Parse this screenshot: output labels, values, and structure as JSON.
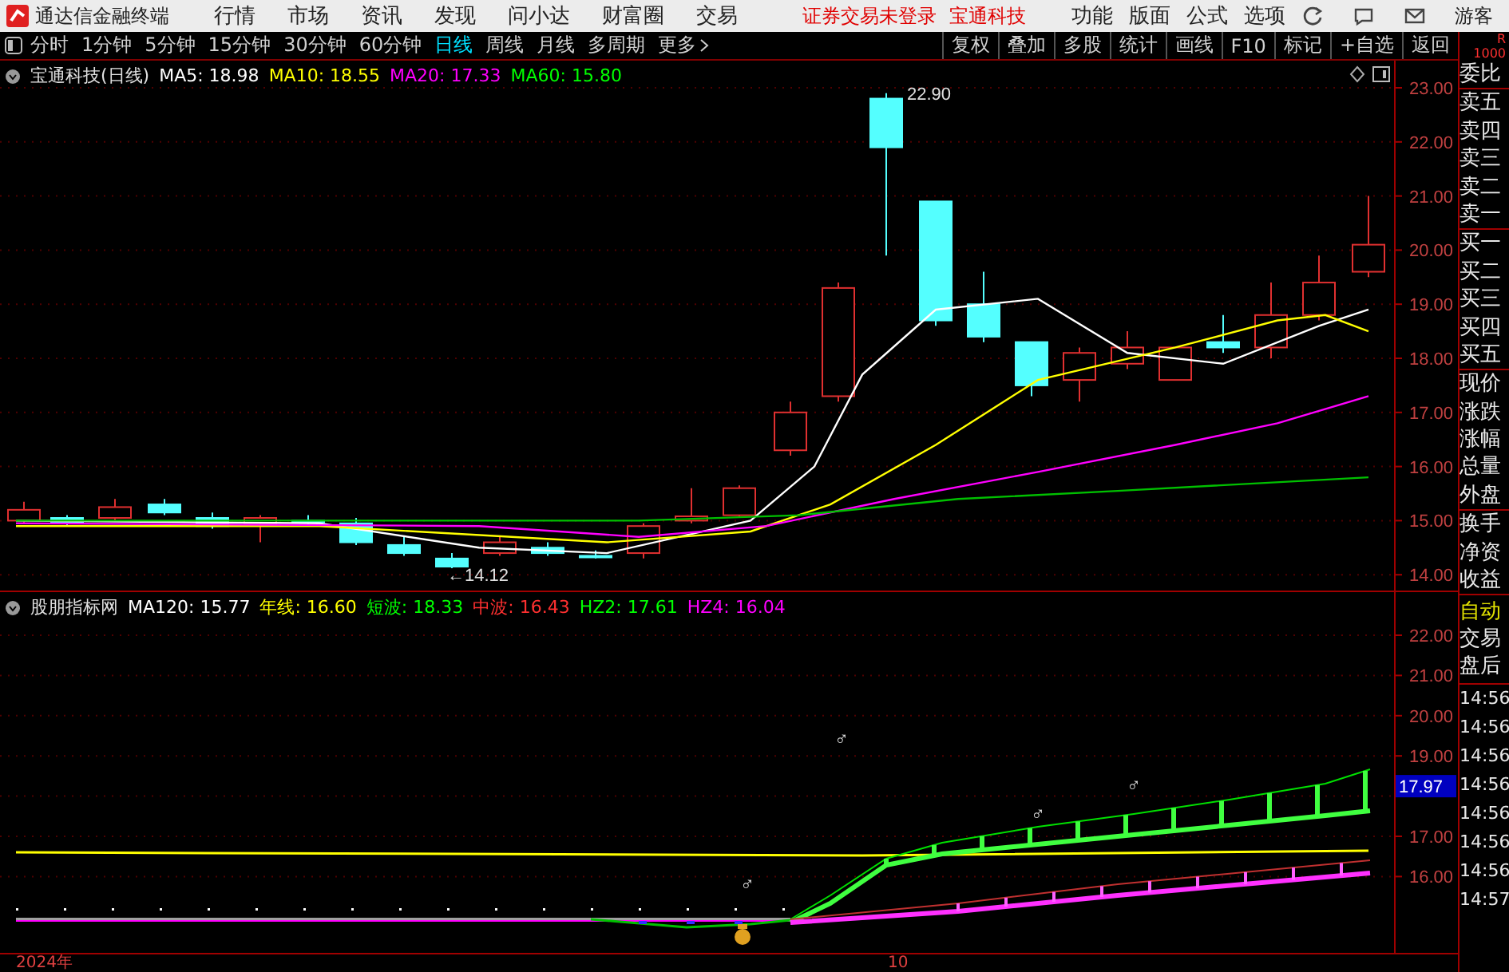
{
  "app": {
    "title": "通达信金融终端"
  },
  "menu": [
    "行情",
    "市场",
    "资讯",
    "发现",
    "问小达",
    "财富圈",
    "交易"
  ],
  "login_status": "证券交易未登录",
  "stock_link": "宝通科技",
  "right_menu": [
    "功能",
    "版面",
    "公式",
    "选项"
  ],
  "user": "游客",
  "toolbar": {
    "periods": [
      {
        "label": "分时",
        "selected": false
      },
      {
        "label": "1分钟",
        "selected": false
      },
      {
        "label": "5分钟",
        "selected": false
      },
      {
        "label": "15分钟",
        "selected": false
      },
      {
        "label": "30分钟",
        "selected": false
      },
      {
        "label": "60分钟",
        "selected": false
      },
      {
        "label": "日线",
        "selected": true
      },
      {
        "label": "周线",
        "selected": false
      },
      {
        "label": "月线",
        "selected": false
      },
      {
        "label": "多周期",
        "selected": false
      }
    ],
    "more": "更多",
    "buttons": [
      "复权",
      "叠加",
      "多股",
      "统计",
      "画线",
      "F10",
      "标记",
      "+自选",
      "返回"
    ]
  },
  "side_header": {
    "label": "R",
    "value": "1000"
  },
  "main_chart": {
    "title": "宝通科技(日线)",
    "legend": [
      {
        "label": "MA5: 18.98",
        "color": "#ffffff"
      },
      {
        "label": "MA10: 18.55",
        "color": "#ffff00"
      },
      {
        "label": "MA20: 17.33",
        "color": "#ff00ff"
      },
      {
        "label": "MA60: 15.80",
        "color": "#00ff00"
      }
    ],
    "price_ticks": [
      "23.00",
      "22.00",
      "21.00",
      "20.00",
      "19.00",
      "18.00",
      "17.00",
      "16.00",
      "15.00",
      "14.00"
    ],
    "high_label": "22.90",
    "low_label": "←14.12"
  },
  "indicator": {
    "title": "股朋指标网",
    "legend": [
      {
        "label": "MA120: 15.77",
        "color": "#ffffff"
      },
      {
        "label": "年线: 16.60",
        "color": "#ffff00"
      },
      {
        "label": "短波: 18.33",
        "color": "#00ff00"
      },
      {
        "label": "中波: 16.43",
        "color": "#ff3030"
      },
      {
        "label": "HZ2: 17.61",
        "color": "#00ff00"
      },
      {
        "label": "HZ4: 16.04",
        "color": "#ff00ff"
      }
    ],
    "ticks": [
      "22.00",
      "21.00",
      "20.00",
      "19.00",
      "17.00",
      "16.00"
    ],
    "price_flag": "17.97",
    "markers": [
      "♂",
      "♂",
      "♂",
      "♂"
    ]
  },
  "x_axis": [
    "2024年",
    "10"
  ],
  "quote_fields": [
    "委比",
    "卖五",
    "卖四",
    "卖三",
    "卖二",
    "卖一",
    "买一",
    "买二",
    "买三",
    "买四",
    "买五",
    "现价",
    "涨跌",
    "涨幅",
    "总量",
    "外盘",
    "换手",
    "净资",
    "收益"
  ],
  "side_modes": [
    {
      "label": "自动",
      "selected": true
    },
    {
      "label": "交易",
      "selected": false
    },
    {
      "label": "盘后",
      "selected": false
    }
  ],
  "tick_times": [
    "14:56",
    "14:56",
    "14:56",
    "14:56",
    "14:56",
    "14:56",
    "14:56",
    "14:57"
  ]
}
